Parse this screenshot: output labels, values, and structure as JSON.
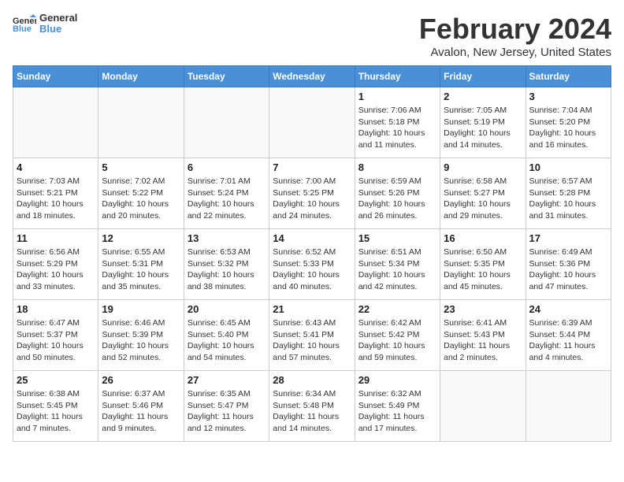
{
  "logo": {
    "line1": "General",
    "line2": "Blue"
  },
  "title": "February 2024",
  "location": "Avalon, New Jersey, United States",
  "days_of_week": [
    "Sunday",
    "Monday",
    "Tuesday",
    "Wednesday",
    "Thursday",
    "Friday",
    "Saturday"
  ],
  "weeks": [
    [
      {
        "day": "",
        "info": ""
      },
      {
        "day": "",
        "info": ""
      },
      {
        "day": "",
        "info": ""
      },
      {
        "day": "",
        "info": ""
      },
      {
        "day": "1",
        "info": "Sunrise: 7:06 AM\nSunset: 5:18 PM\nDaylight: 10 hours\nand 11 minutes."
      },
      {
        "day": "2",
        "info": "Sunrise: 7:05 AM\nSunset: 5:19 PM\nDaylight: 10 hours\nand 14 minutes."
      },
      {
        "day": "3",
        "info": "Sunrise: 7:04 AM\nSunset: 5:20 PM\nDaylight: 10 hours\nand 16 minutes."
      }
    ],
    [
      {
        "day": "4",
        "info": "Sunrise: 7:03 AM\nSunset: 5:21 PM\nDaylight: 10 hours\nand 18 minutes."
      },
      {
        "day": "5",
        "info": "Sunrise: 7:02 AM\nSunset: 5:22 PM\nDaylight: 10 hours\nand 20 minutes."
      },
      {
        "day": "6",
        "info": "Sunrise: 7:01 AM\nSunset: 5:24 PM\nDaylight: 10 hours\nand 22 minutes."
      },
      {
        "day": "7",
        "info": "Sunrise: 7:00 AM\nSunset: 5:25 PM\nDaylight: 10 hours\nand 24 minutes."
      },
      {
        "day": "8",
        "info": "Sunrise: 6:59 AM\nSunset: 5:26 PM\nDaylight: 10 hours\nand 26 minutes."
      },
      {
        "day": "9",
        "info": "Sunrise: 6:58 AM\nSunset: 5:27 PM\nDaylight: 10 hours\nand 29 minutes."
      },
      {
        "day": "10",
        "info": "Sunrise: 6:57 AM\nSunset: 5:28 PM\nDaylight: 10 hours\nand 31 minutes."
      }
    ],
    [
      {
        "day": "11",
        "info": "Sunrise: 6:56 AM\nSunset: 5:29 PM\nDaylight: 10 hours\nand 33 minutes."
      },
      {
        "day": "12",
        "info": "Sunrise: 6:55 AM\nSunset: 5:31 PM\nDaylight: 10 hours\nand 35 minutes."
      },
      {
        "day": "13",
        "info": "Sunrise: 6:53 AM\nSunset: 5:32 PM\nDaylight: 10 hours\nand 38 minutes."
      },
      {
        "day": "14",
        "info": "Sunrise: 6:52 AM\nSunset: 5:33 PM\nDaylight: 10 hours\nand 40 minutes."
      },
      {
        "day": "15",
        "info": "Sunrise: 6:51 AM\nSunset: 5:34 PM\nDaylight: 10 hours\nand 42 minutes."
      },
      {
        "day": "16",
        "info": "Sunrise: 6:50 AM\nSunset: 5:35 PM\nDaylight: 10 hours\nand 45 minutes."
      },
      {
        "day": "17",
        "info": "Sunrise: 6:49 AM\nSunset: 5:36 PM\nDaylight: 10 hours\nand 47 minutes."
      }
    ],
    [
      {
        "day": "18",
        "info": "Sunrise: 6:47 AM\nSunset: 5:37 PM\nDaylight: 10 hours\nand 50 minutes."
      },
      {
        "day": "19",
        "info": "Sunrise: 6:46 AM\nSunset: 5:39 PM\nDaylight: 10 hours\nand 52 minutes."
      },
      {
        "day": "20",
        "info": "Sunrise: 6:45 AM\nSunset: 5:40 PM\nDaylight: 10 hours\nand 54 minutes."
      },
      {
        "day": "21",
        "info": "Sunrise: 6:43 AM\nSunset: 5:41 PM\nDaylight: 10 hours\nand 57 minutes."
      },
      {
        "day": "22",
        "info": "Sunrise: 6:42 AM\nSunset: 5:42 PM\nDaylight: 10 hours\nand 59 minutes."
      },
      {
        "day": "23",
        "info": "Sunrise: 6:41 AM\nSunset: 5:43 PM\nDaylight: 11 hours\nand 2 minutes."
      },
      {
        "day": "24",
        "info": "Sunrise: 6:39 AM\nSunset: 5:44 PM\nDaylight: 11 hours\nand 4 minutes."
      }
    ],
    [
      {
        "day": "25",
        "info": "Sunrise: 6:38 AM\nSunset: 5:45 PM\nDaylight: 11 hours\nand 7 minutes."
      },
      {
        "day": "26",
        "info": "Sunrise: 6:37 AM\nSunset: 5:46 PM\nDaylight: 11 hours\nand 9 minutes."
      },
      {
        "day": "27",
        "info": "Sunrise: 6:35 AM\nSunset: 5:47 PM\nDaylight: 11 hours\nand 12 minutes."
      },
      {
        "day": "28",
        "info": "Sunrise: 6:34 AM\nSunset: 5:48 PM\nDaylight: 11 hours\nand 14 minutes."
      },
      {
        "day": "29",
        "info": "Sunrise: 6:32 AM\nSunset: 5:49 PM\nDaylight: 11 hours\nand 17 minutes."
      },
      {
        "day": "",
        "info": ""
      },
      {
        "day": "",
        "info": ""
      }
    ]
  ]
}
